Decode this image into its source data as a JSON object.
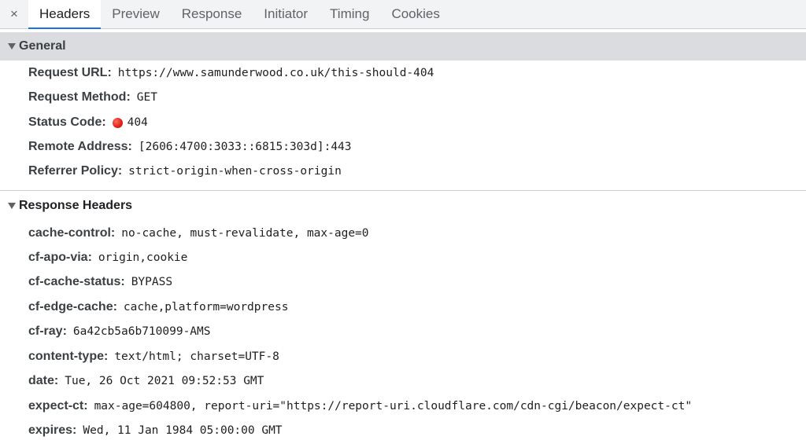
{
  "tabbar": {
    "close_label": "×",
    "tabs": [
      {
        "label": "Headers"
      },
      {
        "label": "Preview"
      },
      {
        "label": "Response"
      },
      {
        "label": "Initiator"
      },
      {
        "label": "Timing"
      },
      {
        "label": "Cookies"
      }
    ],
    "active_tab": "Headers"
  },
  "general": {
    "title": "General",
    "rows": [
      {
        "key": "Request URL:",
        "value": "https://www.samunderwood.co.uk/this-should-404"
      },
      {
        "key": "Request Method:",
        "value": "GET"
      },
      {
        "key": "Status Code:",
        "value": "404",
        "status_color": "#e0261a"
      },
      {
        "key": "Remote Address:",
        "value": "[2606:4700:3033::6815:303d]:443"
      },
      {
        "key": "Referrer Policy:",
        "value": "strict-origin-when-cross-origin"
      }
    ]
  },
  "response_headers": {
    "title": "Response Headers",
    "rows": [
      {
        "key": "cache-control:",
        "value": "no-cache, must-revalidate, max-age=0"
      },
      {
        "key": "cf-apo-via:",
        "value": "origin,cookie"
      },
      {
        "key": "cf-cache-status:",
        "value": "BYPASS"
      },
      {
        "key": "cf-edge-cache:",
        "value": "cache,platform=wordpress"
      },
      {
        "key": "cf-ray:",
        "value": "6a42cb5a6b710099-AMS"
      },
      {
        "key": "content-type:",
        "value": "text/html; charset=UTF-8"
      },
      {
        "key": "date:",
        "value": "Tue, 26 Oct 2021 09:52:53 GMT"
      },
      {
        "key": "expect-ct:",
        "value": "max-age=604800, report-uri=\"https://report-uri.cloudflare.com/cdn-cgi/beacon/expect-ct\""
      },
      {
        "key": "expires:",
        "value": "Wed, 11 Jan 1984 05:00:00 GMT"
      }
    ]
  },
  "colors": {
    "accent": "#1a73e8",
    "status_error": "#e0261a"
  }
}
